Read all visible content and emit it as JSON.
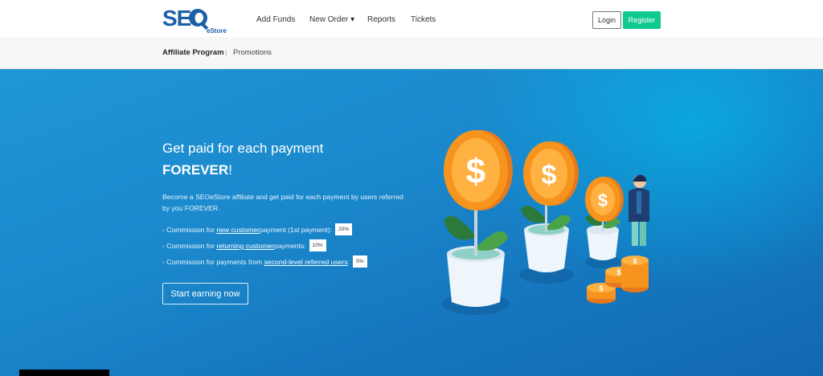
{
  "header": {
    "logo_text": "SEO",
    "logo_sub": "eStore",
    "nav": [
      {
        "label": "Add Funds"
      },
      {
        "label": "New Order ▾"
      },
      {
        "label": "Reports"
      },
      {
        "label": "Tickets"
      }
    ],
    "login_label": "Login",
    "register_label": "Register"
  },
  "subnav": {
    "active": "Affiliate Program",
    "separator": "|",
    "other": "Promotions"
  },
  "hero": {
    "title_line1": "Get paid for each payment",
    "title_line2_bold": "FOREVER",
    "title_line2_tail": "!",
    "description": "Become a SEOeStore affiliate and get paid for each payment by users referred by you FOREVER.",
    "commissions": [
      {
        "prefix": "- Commission for ",
        "link": "new customer",
        "suffix": " payment (1st payment):",
        "value": "20%"
      },
      {
        "prefix": "- Commission for ",
        "link": "returning customer",
        "suffix": " payments:",
        "value": "10%"
      },
      {
        "prefix": "- Commission for payments from ",
        "link": "second-level referred users",
        "suffix": ":",
        "value": "5%"
      }
    ],
    "cta_label": "Start earning now"
  },
  "colors": {
    "brand": "#1b5fa8",
    "register": "#10c98f",
    "hero_bg": "#1b88cc",
    "coin": "#f7941d"
  },
  "icons": {
    "dropdown": "chevron-down-icon",
    "illustration": "money-plant-illustration"
  }
}
